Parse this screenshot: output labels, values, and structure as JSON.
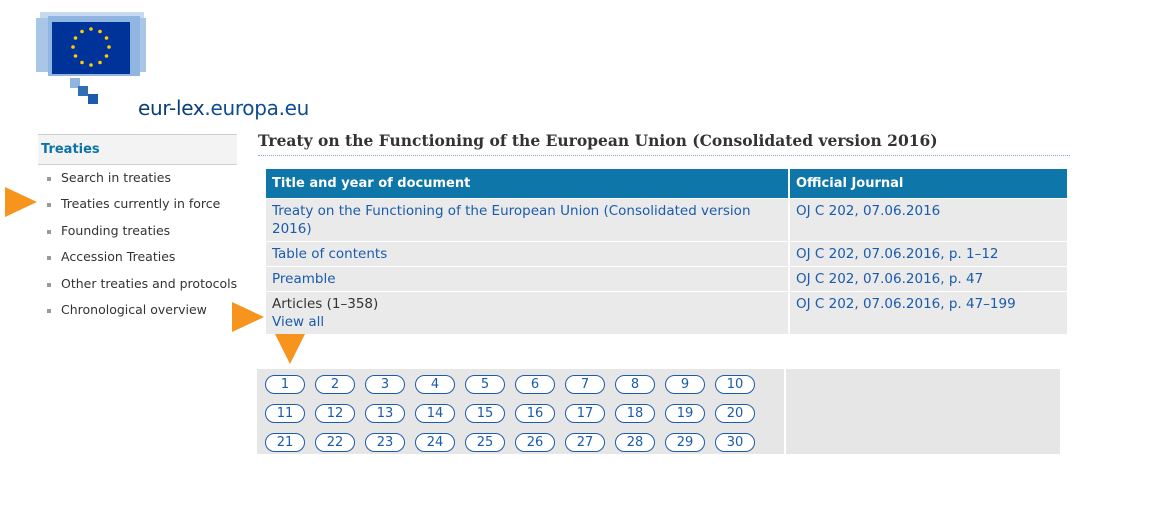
{
  "logo": {
    "text_part1": "eur-lex",
    "text_part2": ".europa.eu"
  },
  "sidebar": {
    "heading": "Treaties",
    "items": [
      "Search in treaties",
      "Treaties currently in force",
      "Founding treaties",
      "Accession Treaties",
      "Other treaties and protocols",
      "Chronological overview"
    ]
  },
  "page_title": "Treaty on the Functioning of the European Union (Consolidated version 2016)",
  "table": {
    "headers": [
      "Title and year of document",
      "Official Journal"
    ],
    "rows": [
      {
        "title": "Treaty on the Functioning of the European Union (Consolidated version 2016)",
        "journal": "OJ C 202, 07.06.2016"
      },
      {
        "title": "Table of contents",
        "journal": "OJ C 202, 07.06.2016, p. 1–12"
      },
      {
        "title": "Preamble",
        "journal": "OJ C 202, 07.06.2016, p. 47"
      },
      {
        "title": "Articles (1–358)",
        "link": "View all",
        "journal": "OJ C 202, 07.06.2016, p. 47–199"
      }
    ]
  },
  "pager": {
    "pages": [
      "1",
      "2",
      "3",
      "4",
      "5",
      "6",
      "7",
      "8",
      "9",
      "10",
      "11",
      "12",
      "13",
      "14",
      "15",
      "16",
      "17",
      "18",
      "19",
      "20",
      "21",
      "22",
      "23",
      "24",
      "25",
      "26",
      "27",
      "28",
      "29",
      "30"
    ]
  },
  "colors": {
    "accent": "#0e76a8",
    "link": "#1b5bab",
    "arrow": "#f7941d",
    "row_bg": "#eaeaea"
  }
}
